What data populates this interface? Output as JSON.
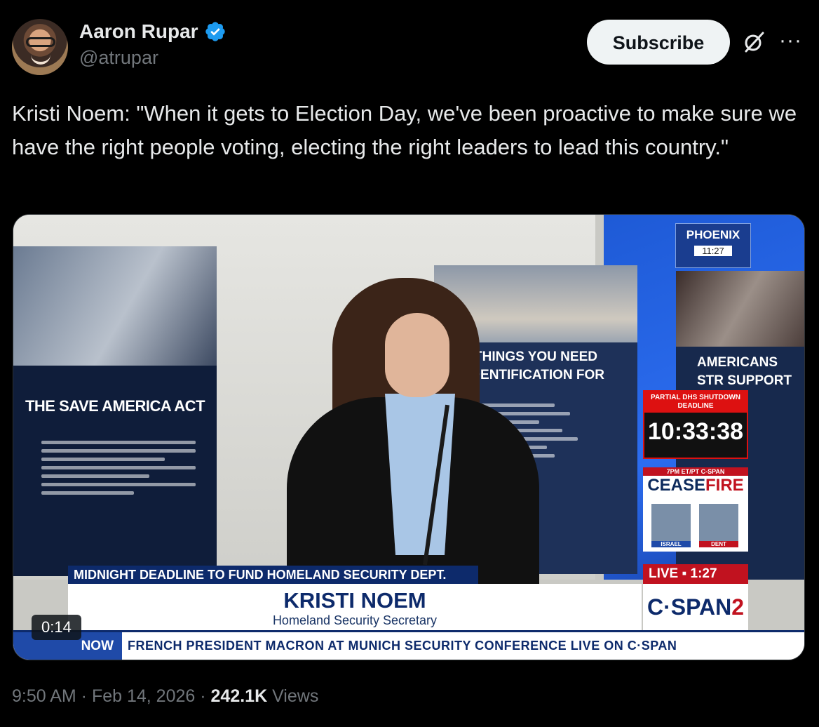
{
  "author": {
    "display_name": "Aaron Rupar",
    "handle": "@atrupar",
    "verified": true
  },
  "actions": {
    "subscribe_label": "Subscribe",
    "grok_icon": "grok-icon",
    "more_icon": "more-icon",
    "more_label": "···"
  },
  "tweet": {
    "text": "Kristi Noem: \"When it gets to Election Day, we've been proactive to make sure we have the right people voting, electing the right leaders to lead this country.\""
  },
  "video": {
    "duration": "0:14",
    "overlays": {
      "location": "PHOENIX",
      "local_time": "11:27",
      "countdown_label": "PARTIAL DHS SHUTDOWN DEADLINE",
      "countdown_time": "10:33:38",
      "cf_top": "7PM ET/PT C-SPAN",
      "cf_word_a": "CEASE",
      "cf_word_b": "FIRE",
      "face_left_label": "ISRAEL",
      "face_right_label": "DENT",
      "lower_bar": "MIDNIGHT DEADLINE TO FUND HOMELAND SECURITY DEPT.",
      "person_name": "KRISTI NOEM",
      "person_title": "Homeland Security Secretary",
      "live_label": "LIVE ▪ 1:27",
      "network_a": "C·SPAN",
      "network_b": "2",
      "ticker_prefix": "NOW",
      "ticker_text": "FRENCH PRESIDENT MACRON AT MUNICH SECURITY CONFERENCE  LIVE ON C·SPAN"
    },
    "posters": {
      "left_title": "THE SAVE AMERICA ACT",
      "center_title": "THINGS YOU NEED IDENTIFICATION FOR",
      "right_title": "AMERICANS STR SUPPORT VOT"
    }
  },
  "meta": {
    "time": "9:50 AM",
    "sep1": " · ",
    "date": "Feb 14, 2026",
    "sep2": " · ",
    "views_count": "242.1K",
    "views_label": " Views"
  },
  "colors": {
    "background": "#000000",
    "verified": "#1d9bf0",
    "muted": "#71767b"
  }
}
